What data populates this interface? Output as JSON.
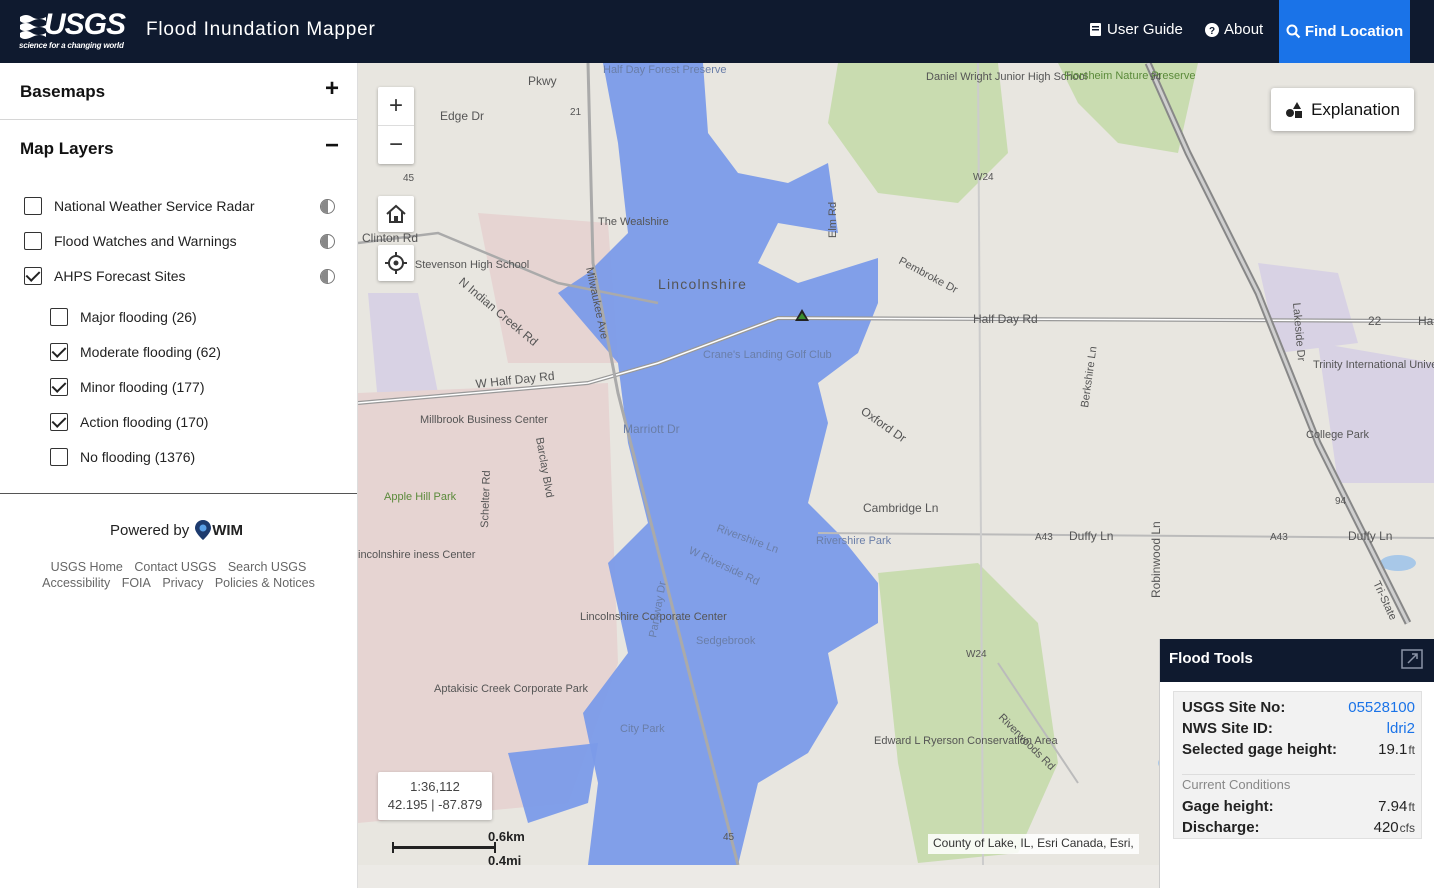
{
  "header": {
    "logo_text": "USGS",
    "logo_tagline": "science for a changing world",
    "app_title": "Flood Inundation Mapper",
    "user_guide": "User Guide",
    "about": "About",
    "find_location": "Find Location"
  },
  "sidebar": {
    "basemaps_title": "Basemaps",
    "map_layers_title": "Map Layers",
    "layers": [
      {
        "label": "National Weather Service Radar",
        "checked": false
      },
      {
        "label": "Flood Watches and Warnings",
        "checked": false
      },
      {
        "label": "AHPS Forecast Sites",
        "checked": true
      }
    ],
    "sublayers": [
      {
        "label": "Major flooding (26)",
        "checked": false
      },
      {
        "label": "Moderate flooding (62)",
        "checked": true
      },
      {
        "label": "Minor flooding (177)",
        "checked": true
      },
      {
        "label": "Action flooding (170)",
        "checked": true
      },
      {
        "label": "No flooding (1376)",
        "checked": false
      }
    ],
    "powered_by": "Powered by",
    "wim": "WIM",
    "footer_row1": [
      "USGS Home",
      "Contact USGS",
      "Search USGS"
    ],
    "footer_row2": [
      "Accessibility",
      "FOIA",
      "Privacy",
      "Policies & Notices"
    ]
  },
  "map": {
    "explanation_label": "Explanation",
    "scale": "1:36,112",
    "coords": "42.195 | -87.879",
    "scalebar_km": "0.6km",
    "scalebar_mi": "0.4mi",
    "attribution": "County of Lake, IL, Esri Canada, Esri,",
    "labels": {
      "lincolnshire": "Lincolnshire",
      "half_day_rd": "Half Day Rd",
      "w_half_day_rd": "W Half Day Rd",
      "milwaukee_ave": "Milwaukee Ave",
      "cranes_landing": "Crane's Landing Golf Club",
      "trinity": "Trinity International University",
      "college_park": "College Park",
      "millbrook": "Millbrook Business Center",
      "apple_hill": "Apple Hill Park",
      "lincolnshire_corp": "Lincolnshire Corporate Center",
      "aptakisic": "Aptakisic Creek Corporate Park",
      "edward_ryerson": "Edward L Ryerson Conservation Area",
      "daniel_wright": "Daniel Wright Junior High School",
      "florsheim": "Florsheim Nature Preserve",
      "half_day_forest": "Half Day Forest Preserve",
      "duffy_ln": "Duffy Ln",
      "riverwoods_rd": "Riverwoods Rd",
      "city_park": "City Park",
      "sedgebrook": "Sedgebrook",
      "cambridge_ln": "Cambridge Ln",
      "oxford_dr": "Oxford Dr",
      "marriott_dr": "Marriott Dr",
      "edge_dr": "Edge Dr",
      "clinton_rd": "Clinton Rd",
      "indian_creek_rd": "N Indian Creek Rd",
      "robinwood_ln": "Robinwood Ln",
      "berkshire_ln": "Berkshire Ln",
      "lakeside_dr": "Lakeside Dr",
      "pembroke_dr": "Pembroke Dr",
      "elm_rd": "Elm Rd",
      "schelter_rd": "Schelter Rd",
      "barclay_blvd": "Barclay Blvd",
      "parkway_dr": "Parkway Dr",
      "riverside_rd": "W Riverside Rd",
      "rivershire_ln": "Rivershire Ln",
      "the_wealshire": "The Wealshire",
      "stevenson": "Ad E Stevenson High School",
      "lincolnshire_bc": "incolnshire iness Center",
      "riverside_park": "Rivershire Park",
      "tri_state": "Tri-State",
      "pkwy": "Pkwy",
      "w24": "W24",
      "a43": "A43",
      "r94": "94",
      "r21": "21",
      "r45": "45",
      "r22": "22",
      "ha": "Ha"
    }
  },
  "flood_tools": {
    "title": "Flood Tools",
    "site_no_label": "USGS Site No:",
    "site_no": "05528100",
    "nws_label": "NWS Site ID:",
    "nws_id": "ldri2",
    "selected_label": "Selected gage height:",
    "selected_value": "19.1",
    "selected_unit": "ft",
    "current_conditions": "Current Conditions",
    "gage_label": "Gage height:",
    "gage_value": "7.94",
    "gage_unit": "ft",
    "discharge_label": "Discharge:",
    "discharge_value": "420",
    "discharge_unit": "cfs"
  }
}
